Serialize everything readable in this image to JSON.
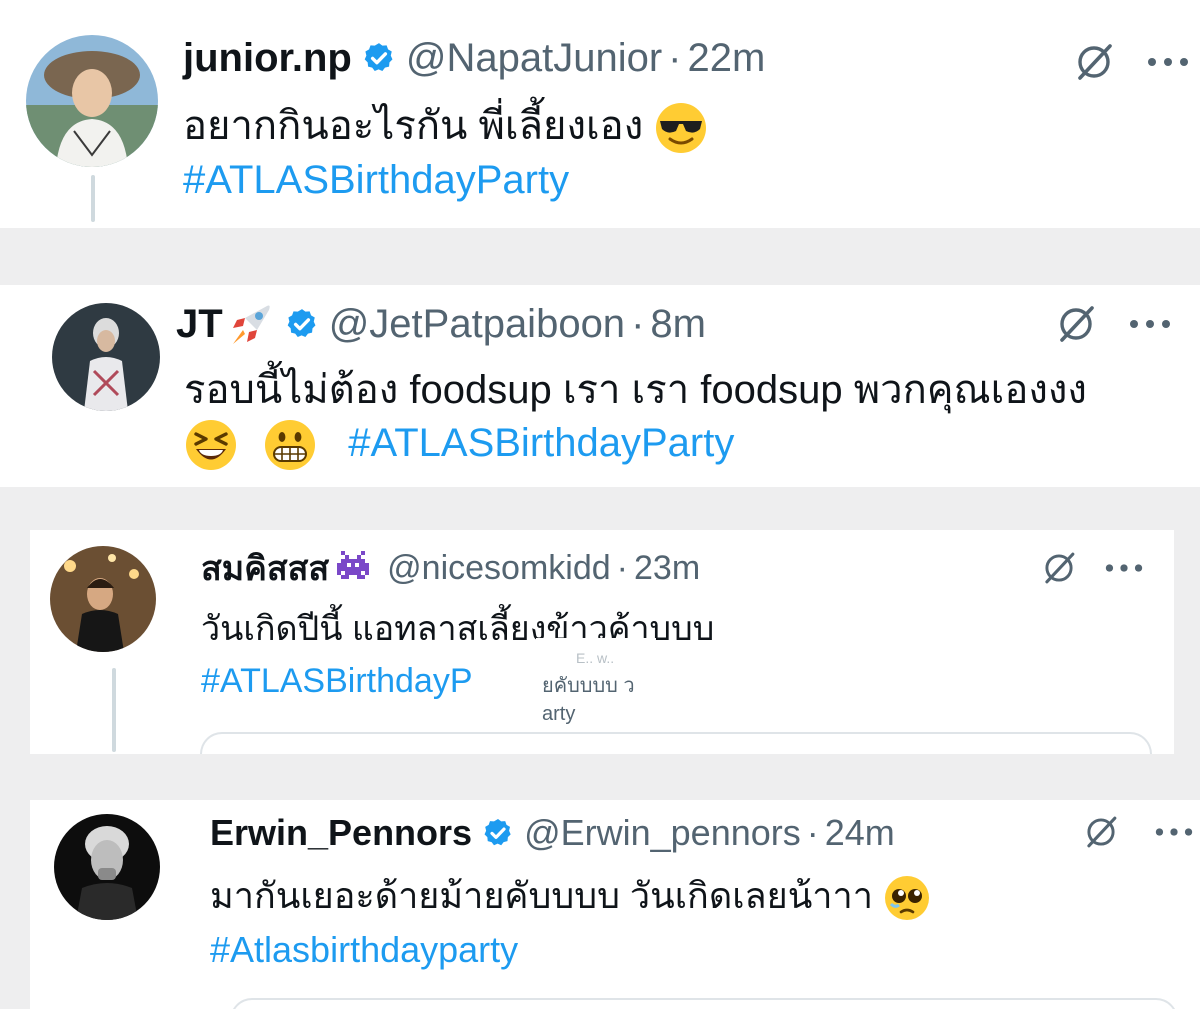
{
  "tweets": [
    {
      "name": "junior.np",
      "handle": "@NapatJunior",
      "separator": "·",
      "time": "22m",
      "verified": true,
      "text_line1": "อยากกินอะไรกัน พี่เลี้ยงเอง",
      "text_line1_emoji": "smiling-face-with-sunglasses",
      "hashtag": "#ATLASBirthdayParty"
    },
    {
      "name": "JT",
      "name_emoji": "rocket",
      "handle": "@JetPatpaiboon",
      "separator": "·",
      "time": "8m",
      "verified": true,
      "text_line1": "รอบนี้ไม่ต้อง foodsup เรา เรา foodsup พวกคุณเองงง",
      "line2_emojis": [
        "grinning-squinting-face",
        "grimacing-face"
      ],
      "hashtag": "#ATLASBirthdayParty"
    },
    {
      "name": "สมคิสสส",
      "name_emoji": "alien-monster",
      "handle": "@nicesomkidd",
      "separator": "·",
      "time": "23m",
      "verified": false,
      "text_line1": "วันเกิดปีนี้ แอทลาสเลี้ยงข้าวค้าบบบ",
      "hashtag": "#ATLASBirthdayP",
      "overlay_line1": "E.. w..",
      "overlay_line2": "ยคับบบบ ว",
      "overlay_line3": "arty"
    },
    {
      "name": "Erwin_Pennors",
      "handle": "@Erwin_pennors",
      "separator": "·",
      "time": "24m",
      "verified": true,
      "text_line1": "มากันเยอะด้ายม้ายคับบบบ วันเกิดเลยน้าาา",
      "text_line1_emoji": "pleading-face",
      "hashtag": "#Atlasbirthdayparty"
    }
  ],
  "icons": {
    "verified": "verified-badge-icon",
    "grok": "grok-icon",
    "more": "more-options-icon"
  },
  "colors": {
    "link": "#1d9bf0",
    "muted": "#536471",
    "verified": "#1d9bf0",
    "background": "#eeeeef"
  }
}
